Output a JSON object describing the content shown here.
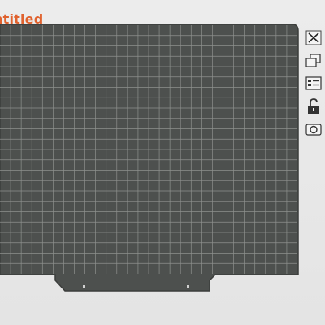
{
  "project": {
    "title": "ntitled"
  },
  "colors": {
    "title": "#e0622e",
    "bed_surface": "#4d504e",
    "bed_border": "#3b3d3b",
    "grid_line": "#8e918e",
    "background": "#e9e9e9",
    "icon": "#333333"
  },
  "bed": {
    "grid_columns": 28,
    "grid_rows": 24
  },
  "toolbar": {
    "items": [
      {
        "name": "close-icon"
      },
      {
        "name": "models-icon"
      },
      {
        "name": "list-view-icon"
      },
      {
        "name": "lock-icon"
      },
      {
        "name": "camera-icon"
      }
    ]
  }
}
